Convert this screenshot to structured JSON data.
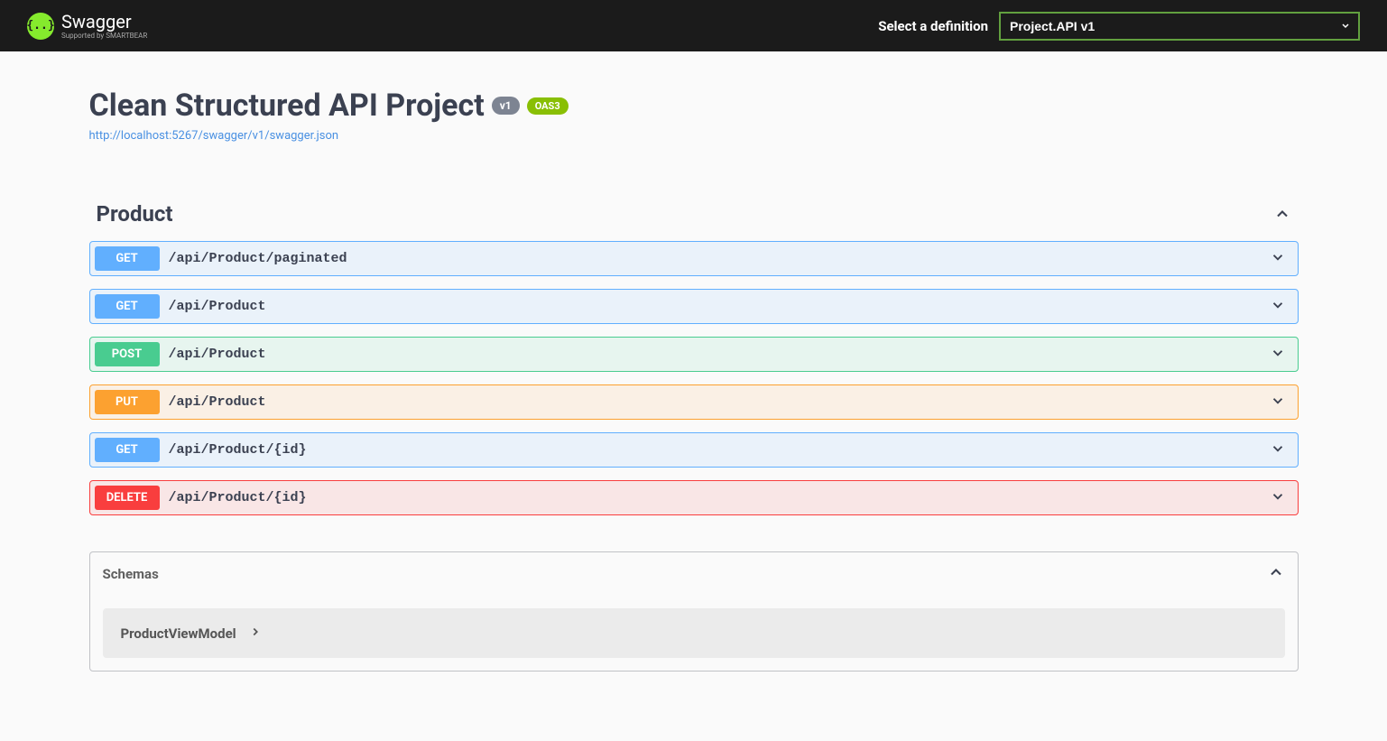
{
  "topbar": {
    "logo_text": "Swagger",
    "logo_sub": "Supported by SMARTBEAR",
    "definition_label": "Select a definition",
    "definition_value": "Project.API v1"
  },
  "header": {
    "title": "Clean Structured API Project",
    "version": "v1",
    "oas": "OAS3",
    "json_url": "http://localhost:5267/swagger/v1/swagger.json"
  },
  "tag": {
    "name": "Product"
  },
  "operations": [
    {
      "method": "GET",
      "path": "/api/Product/paginated"
    },
    {
      "method": "GET",
      "path": "/api/Product"
    },
    {
      "method": "POST",
      "path": "/api/Product"
    },
    {
      "method": "PUT",
      "path": "/api/Product"
    },
    {
      "method": "GET",
      "path": "/api/Product/{id}"
    },
    {
      "method": "DELETE",
      "path": "/api/Product/{id}"
    }
  ],
  "schemas": {
    "title": "Schemas",
    "models": [
      {
        "name": "ProductViewModel"
      }
    ]
  }
}
